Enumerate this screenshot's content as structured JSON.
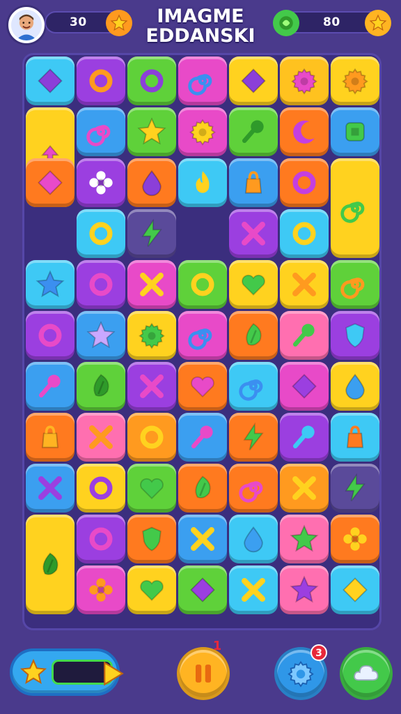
{
  "header": {
    "title_line1": "IMAGME",
    "title_line2": "EDDANSKI",
    "left_counter": "30",
    "right_counter": "80"
  },
  "bottom": {
    "pause_badge": "1",
    "settings_badge": "3"
  },
  "colors": {
    "background": "#4a3a8c",
    "board": "#3b2e7e",
    "coin_orange": "#ff9a1f",
    "gem_green": "#43c94a"
  },
  "board": {
    "columns": 7,
    "tiles": [
      {
        "row": 0,
        "col": 0,
        "bg": "#3ec9f5",
        "icon": "diamond",
        "fg": "#8b3fd9"
      },
      {
        "row": 0,
        "col": 1,
        "bg": "#9b3fe0",
        "icon": "ring",
        "fg": "#ff9a1f"
      },
      {
        "row": 0,
        "col": 2,
        "bg": "#5fd13a",
        "icon": "ring",
        "fg": "#8b3fd9"
      },
      {
        "row": 0,
        "col": 3,
        "bg": "#e84ac8",
        "icon": "swirl",
        "fg": "#3b8ff0"
      },
      {
        "row": 0,
        "col": 4,
        "bg": "#ffd21f",
        "icon": "diamond",
        "fg": "#8b3fd9"
      },
      {
        "row": 0,
        "col": 5,
        "bg": "#ffc21f",
        "icon": "gear",
        "fg": "#e84ac8"
      },
      {
        "row": 0,
        "col": 6,
        "bg": "#ffd21f",
        "icon": "gear",
        "fg": "#ff9a1f"
      },
      {
        "row": 1,
        "col": 0,
        "bg": "#ffd21f",
        "icon": "arrow",
        "fg": "#e84ac8",
        "tall": true
      },
      {
        "row": 1,
        "col": 1,
        "bg": "#3b9ff0",
        "icon": "swirl",
        "fg": "#e84ac8"
      },
      {
        "row": 1,
        "col": 2,
        "bg": "#5fd13a",
        "icon": "star",
        "fg": "#ffd21f"
      },
      {
        "row": 1,
        "col": 3,
        "bg": "#e84ac8",
        "icon": "gear",
        "fg": "#ffd21f"
      },
      {
        "row": 1,
        "col": 4,
        "bg": "#5fd13a",
        "icon": "key",
        "fg": "#2f9a2a"
      },
      {
        "row": 1,
        "col": 5,
        "bg": "#ff7a1f",
        "icon": "crescent",
        "fg": "#c43fe0"
      },
      {
        "row": 1,
        "col": 6,
        "bg": "#3b9ff0",
        "icon": "square",
        "fg": "#43c94a"
      },
      {
        "row": 2,
        "col": 0,
        "bg": "#ff7a1f",
        "icon": "diamond",
        "fg": "#e84ac8"
      },
      {
        "row": 2,
        "col": 1,
        "bg": "#9b3fe0",
        "icon": "flower",
        "fg": "#ffffff"
      },
      {
        "row": 2,
        "col": 2,
        "bg": "#ff7a1f",
        "icon": "drop",
        "fg": "#8b3fd9"
      },
      {
        "row": 2,
        "col": 3,
        "bg": "#3ec9f5",
        "icon": "flame",
        "fg": "#ffd21f"
      },
      {
        "row": 2,
        "col": 4,
        "bg": "#3b9ff0",
        "icon": "bag",
        "fg": "#ff9a1f"
      },
      {
        "row": 2,
        "col": 5,
        "bg": "#ff7a1f",
        "icon": "ring",
        "fg": "#c43fe0"
      },
      {
        "row": 2,
        "col": 6,
        "bg": "#ffd21f",
        "icon": "swirl",
        "fg": "#43c94a",
        "tall": true
      },
      {
        "row": 3,
        "col": 1,
        "bg": "#3ec9f5",
        "icon": "ring",
        "fg": "#ffd21f"
      },
      {
        "row": 3,
        "col": 2,
        "bg": "#5a4a9a",
        "icon": "bolt",
        "fg": "#43c94a"
      },
      {
        "row": 3,
        "col": 4,
        "bg": "#9b3fe0",
        "icon": "cross",
        "fg": "#e84ac8"
      },
      {
        "row": 3,
        "col": 5,
        "bg": "#3ec9f5",
        "icon": "ring",
        "fg": "#ffd21f"
      },
      {
        "row": 4,
        "col": 0,
        "bg": "#3ec9f5",
        "icon": "star",
        "fg": "#3b8ff0"
      },
      {
        "row": 4,
        "col": 1,
        "bg": "#9b3fe0",
        "icon": "ring",
        "fg": "#e84ac8"
      },
      {
        "row": 4,
        "col": 2,
        "bg": "#e84ac8",
        "icon": "cross",
        "fg": "#ffd21f"
      },
      {
        "row": 4,
        "col": 3,
        "bg": "#5fd13a",
        "icon": "ring",
        "fg": "#ffd21f"
      },
      {
        "row": 4,
        "col": 4,
        "bg": "#ffd21f",
        "icon": "heart",
        "fg": "#43c94a"
      },
      {
        "row": 4,
        "col": 5,
        "bg": "#ffd21f",
        "icon": "cross",
        "fg": "#ff9a1f"
      },
      {
        "row": 4,
        "col": 6,
        "bg": "#5fd13a",
        "icon": "swirl",
        "fg": "#ff9a1f"
      },
      {
        "row": 5,
        "col": 0,
        "bg": "#9b3fe0",
        "icon": "ring",
        "fg": "#e84ac8"
      },
      {
        "row": 5,
        "col": 1,
        "bg": "#3b9ff0",
        "icon": "star",
        "fg": "#c9a8ff"
      },
      {
        "row": 5,
        "col": 2,
        "bg": "#ffd21f",
        "icon": "gear",
        "fg": "#43c94a"
      },
      {
        "row": 5,
        "col": 3,
        "bg": "#e84ac8",
        "icon": "swirl",
        "fg": "#3b8ff0"
      },
      {
        "row": 5,
        "col": 4,
        "bg": "#ff7a1f",
        "icon": "leaf",
        "fg": "#43c94a"
      },
      {
        "row": 5,
        "col": 5,
        "bg": "#ff6fb0",
        "icon": "key",
        "fg": "#43c94a"
      },
      {
        "row": 5,
        "col": 6,
        "bg": "#9b3fe0",
        "icon": "shield",
        "fg": "#3ec9f5"
      },
      {
        "row": 6,
        "col": 0,
        "bg": "#3b9ff0",
        "icon": "key",
        "fg": "#e84ac8"
      },
      {
        "row": 6,
        "col": 1,
        "bg": "#5fd13a",
        "icon": "leaf",
        "fg": "#2f9a2a"
      },
      {
        "row": 6,
        "col": 2,
        "bg": "#9b3fe0",
        "icon": "cross",
        "fg": "#e84ac8"
      },
      {
        "row": 6,
        "col": 3,
        "bg": "#ff7a1f",
        "icon": "heart",
        "fg": "#e84ac8"
      },
      {
        "row": 6,
        "col": 4,
        "bg": "#3ec9f5",
        "icon": "swirl",
        "fg": "#3b8ff0"
      },
      {
        "row": 6,
        "col": 5,
        "bg": "#e84ac8",
        "icon": "diamond",
        "fg": "#9b3fe0"
      },
      {
        "row": 6,
        "col": 6,
        "bg": "#ffd21f",
        "icon": "drop",
        "fg": "#3b9ff0"
      },
      {
        "row": 7,
        "col": 0,
        "bg": "#ff7a1f",
        "icon": "bag",
        "fg": "#ffb422"
      },
      {
        "row": 7,
        "col": 1,
        "bg": "#ff6fb0",
        "icon": "cross",
        "fg": "#ff9a1f"
      },
      {
        "row": 7,
        "col": 2,
        "bg": "#ff9a1f",
        "icon": "ring",
        "fg": "#ffd21f"
      },
      {
        "row": 7,
        "col": 3,
        "bg": "#3b9ff0",
        "icon": "key",
        "fg": "#e84ac8"
      },
      {
        "row": 7,
        "col": 4,
        "bg": "#ff7a1f",
        "icon": "bolt",
        "fg": "#43c94a"
      },
      {
        "row": 7,
        "col": 5,
        "bg": "#9b3fe0",
        "icon": "key",
        "fg": "#3ec9f5"
      },
      {
        "row": 7,
        "col": 6,
        "bg": "#3ec9f5",
        "icon": "bag",
        "fg": "#ff7a1f"
      },
      {
        "row": 8,
        "col": 0,
        "bg": "#3b9ff0",
        "icon": "cross",
        "fg": "#9b3fe0"
      },
      {
        "row": 8,
        "col": 1,
        "bg": "#ffd21f",
        "icon": "ring",
        "fg": "#9b3fe0"
      },
      {
        "row": 8,
        "col": 2,
        "bg": "#5fd13a",
        "icon": "heart",
        "fg": "#43c94a"
      },
      {
        "row": 8,
        "col": 3,
        "bg": "#ff7a1f",
        "icon": "leaf",
        "fg": "#43c94a"
      },
      {
        "row": 8,
        "col": 4,
        "bg": "#ff7a1f",
        "icon": "swirl",
        "fg": "#e84ac8"
      },
      {
        "row": 8,
        "col": 5,
        "bg": "#ff9a1f",
        "icon": "cross",
        "fg": "#ffd21f"
      },
      {
        "row": 8,
        "col": 6,
        "bg": "#5a4a9a",
        "icon": "bolt",
        "fg": "#43c94a"
      },
      {
        "row": 9,
        "col": 0,
        "bg": "#ffd21f",
        "icon": "leaf",
        "fg": "#2f9a2a",
        "tall": true
      },
      {
        "row": 9,
        "col": 1,
        "bg": "#9b3fe0",
        "icon": "ring",
        "fg": "#e84ac8"
      },
      {
        "row": 9,
        "col": 2,
        "bg": "#ff7a1f",
        "icon": "shield",
        "fg": "#43c94a"
      },
      {
        "row": 9,
        "col": 3,
        "bg": "#3b9ff0",
        "icon": "cross",
        "fg": "#ffd21f"
      },
      {
        "row": 9,
        "col": 4,
        "bg": "#3ec9f5",
        "icon": "drop",
        "fg": "#3b9ff0"
      },
      {
        "row": 9,
        "col": 5,
        "bg": "#ff6fb0",
        "icon": "star",
        "fg": "#43c94a"
      },
      {
        "row": 9,
        "col": 6,
        "bg": "#ff7a1f",
        "icon": "flower",
        "fg": "#ffd21f"
      },
      {
        "row": 10,
        "col": 1,
        "bg": "#e84ac8",
        "icon": "flower",
        "fg": "#ff9a1f"
      },
      {
        "row": 10,
        "col": 2,
        "bg": "#ffd21f",
        "icon": "heart",
        "fg": "#43c94a"
      },
      {
        "row": 10,
        "col": 3,
        "bg": "#5fd13a",
        "icon": "diamond",
        "fg": "#9b3fe0"
      },
      {
        "row": 10,
        "col": 4,
        "bg": "#3ec9f5",
        "icon": "cross",
        "fg": "#ffd21f"
      },
      {
        "row": 10,
        "col": 5,
        "bg": "#ff6fb0",
        "icon": "star",
        "fg": "#9b3fe0"
      },
      {
        "row": 10,
        "col": 6,
        "bg": "#3ec9f5",
        "icon": "diamond",
        "fg": "#ffd21f"
      }
    ]
  }
}
